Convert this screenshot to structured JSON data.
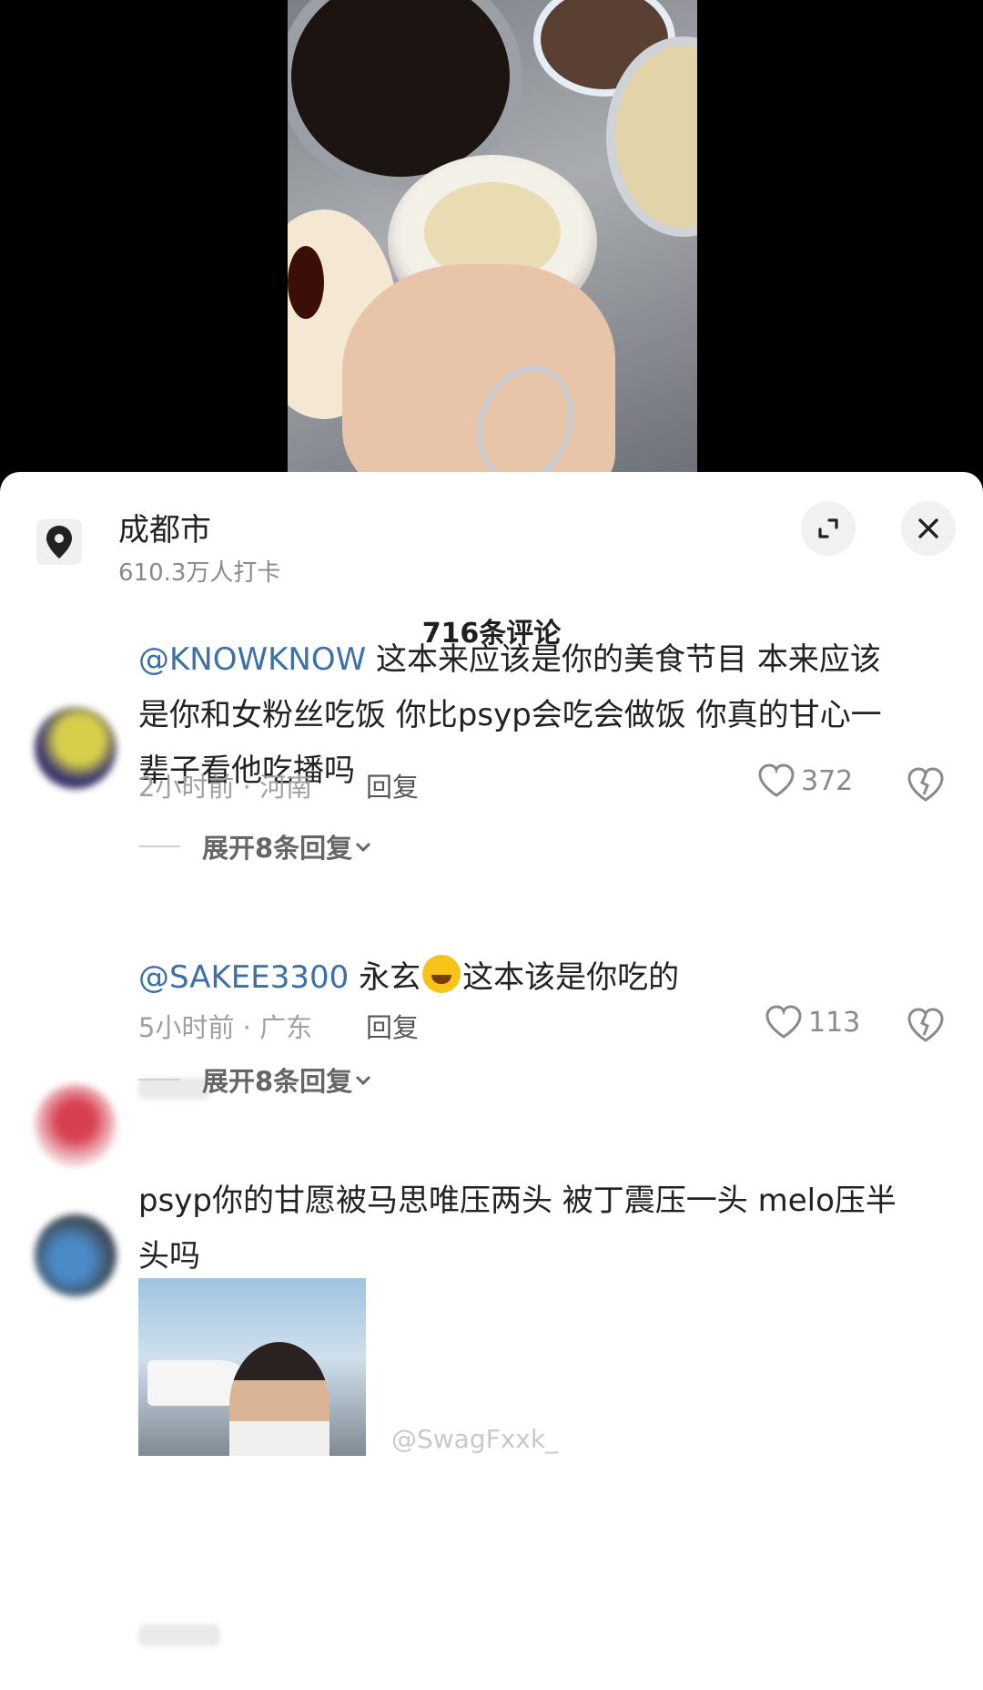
{
  "location": {
    "name": "成都市",
    "checkins": "610.3万人打卡"
  },
  "comments_count": "716条评论",
  "comments": [
    {
      "mention": "@KNOWKNOW",
      "text_line1": " 这本来应该是你的美食节目 本来应该",
      "text_line2": "是你和女粉丝吃饭 你比psyp会吃会做饭 你真的甘心一",
      "text_line3": "辈子看他吃播吗",
      "meta": "2小时前 · 河南",
      "reply_label": "回复",
      "likes": "372",
      "expand_label": "展开8条回复"
    },
    {
      "mention": "@SAKEE3300",
      "text_a": " 永玄",
      "text_b": "这本该是你吃的",
      "meta": "5小时前 · 广东",
      "reply_label": "回复",
      "likes": "113",
      "expand_label": "展开8条回复"
    },
    {
      "text_line1": "psyp你的甘愿被马思唯压两头 被丁震压一头 melo压半",
      "text_line2": "头吗"
    }
  ],
  "watermark": "@SwagFxxk_",
  "icons": {
    "location": "location-pin-icon",
    "expand": "expand-icon",
    "close": "close-icon",
    "like": "heart-icon",
    "dislike": "broken-heart-icon",
    "chevron": "chevron-down-icon",
    "emoji": "laughing-crying-emoji-icon"
  }
}
